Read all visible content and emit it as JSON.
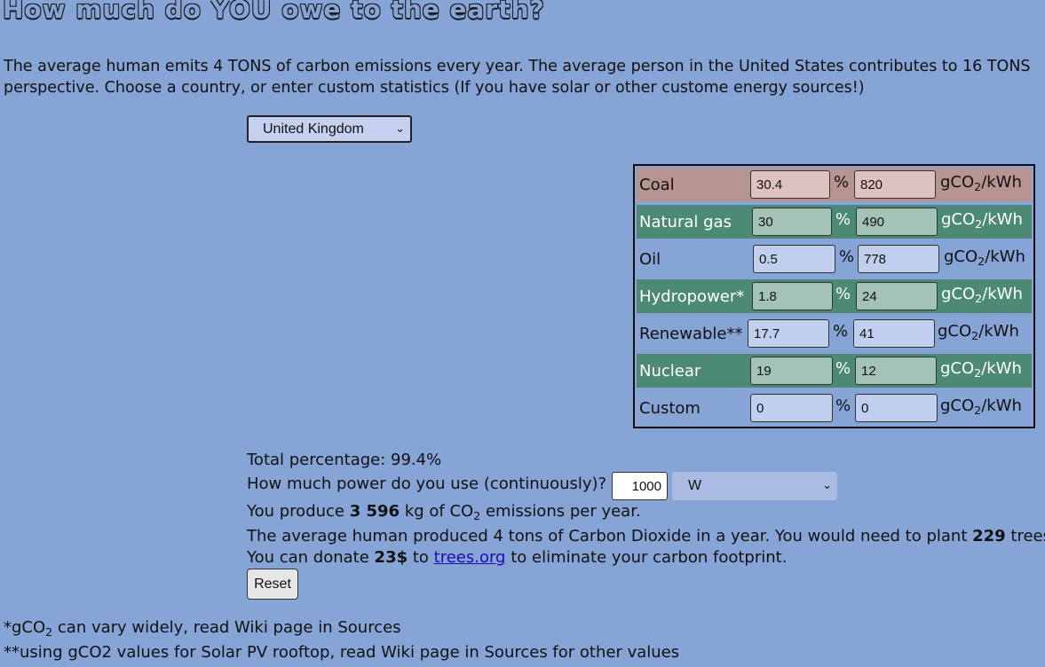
{
  "title": "How much do YOU owe to the earth?",
  "intro": "The average human emits 4 TONS of carbon emissions every year. The average person in the United States contributes to 16 TONS perspective. Choose a country, or enter custom statistics (If you have solar or other custome energy sources!)",
  "country": {
    "selected": "United Kingdom"
  },
  "sources": [
    {
      "label": "Coal",
      "percent": "30.4",
      "gco2": "820",
      "unit": "gCO",
      "unit_sub": "2",
      "unit_end": "/kWh",
      "colors": {
        "row": "#b89490",
        "input": "#ddc2c0"
      }
    },
    {
      "label": "Natural gas",
      "percent": "30",
      "gco2": "490",
      "unit": "gCO",
      "unit_sub": "2",
      "unit_end": "/kWh",
      "colors": {
        "row": "#4c8a76",
        "input": "#a4c3b7"
      }
    },
    {
      "label": "Oil",
      "percent": "0.5",
      "gco2": "778",
      "unit": "gCO",
      "unit_sub": "2",
      "unit_end": "/kWh",
      "colors": {
        "row": "#86a4d6",
        "input": "#c1cfee"
      }
    },
    {
      "label": "Hydropower*",
      "percent": "1.8",
      "gco2": "24",
      "unit": "gCO",
      "unit_sub": "2",
      "unit_end": "/kWh",
      "colors": {
        "row": "#4c8a76",
        "input": "#a4c3b7"
      }
    },
    {
      "label": "Renewable**",
      "percent": "17.7",
      "gco2": "41",
      "unit": "gCO",
      "unit_sub": "2",
      "unit_end": "/kWh",
      "colors": {
        "row": "#86a4d6",
        "input": "#c1cfee"
      }
    },
    {
      "label": "Nuclear",
      "percent": "19",
      "gco2": "12",
      "unit": "gCO",
      "unit_sub": "2",
      "unit_end": "/kWh",
      "colors": {
        "row": "#4c8a76",
        "input": "#a4c3b7"
      }
    },
    {
      "label": "Custom",
      "percent": "0",
      "gco2": "0",
      "unit": "gCO",
      "unit_sub": "2",
      "unit_end": "/kWh",
      "colors": {
        "row": "#86a4d6",
        "input": "#c1cfee"
      }
    }
  ],
  "percent_sign": "%",
  "summary": {
    "total_label": "Total percentage: 99.4%",
    "power_question": "How much power do you use (continuously)?",
    "power_value": "1000",
    "power_unit": "W",
    "produce_pre": "You produce ",
    "produce_value": "3 596",
    "produce_mid": " kg of CO",
    "produce_sub": "2",
    "produce_post": " emissions per year.",
    "trees_pre": "The average human produced 4 tons of Carbon Dioxide in a year. You would need to plant ",
    "trees_value": "229",
    "trees_post": " trees t",
    "donate_pre": "You can donate ",
    "donate_value": "23$",
    "donate_mid": " to ",
    "donate_link": "trees.org",
    "donate_post": " to eliminate your carbon footprint.",
    "reset_label": "Reset"
  },
  "footnotes": {
    "note1_pre": "*gCO",
    "note1_sub": "2",
    "note1_post": " can vary widely, read Wiki page in Sources",
    "note2": "**using gCO2 values for Solar PV rooftop, read Wiki page in Sources for other values"
  },
  "colors": {
    "background": "#86a4d6",
    "link": "#1a0dab"
  }
}
